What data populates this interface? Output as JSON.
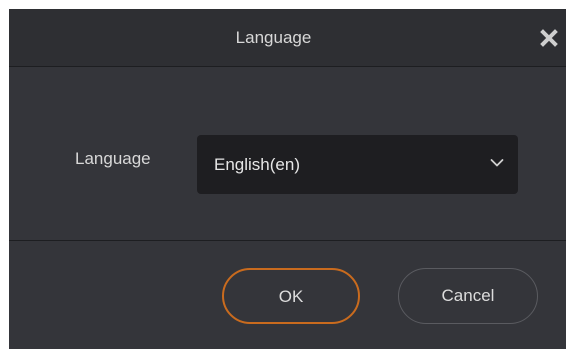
{
  "dialog": {
    "title": "Language",
    "close_icon": "close-icon"
  },
  "form": {
    "language_label": "Language",
    "language_selected": "English(en)",
    "dropdown_icon": "chevron-down-icon"
  },
  "buttons": {
    "ok_label": "OK",
    "cancel_label": "Cancel"
  },
  "colors": {
    "dialog_bg": "#34353a",
    "titlebar_bg": "#2e2f33",
    "select_bg": "#1e1e21",
    "ok_border_accent": "#c96b1e",
    "text": "#d8d8d8"
  }
}
